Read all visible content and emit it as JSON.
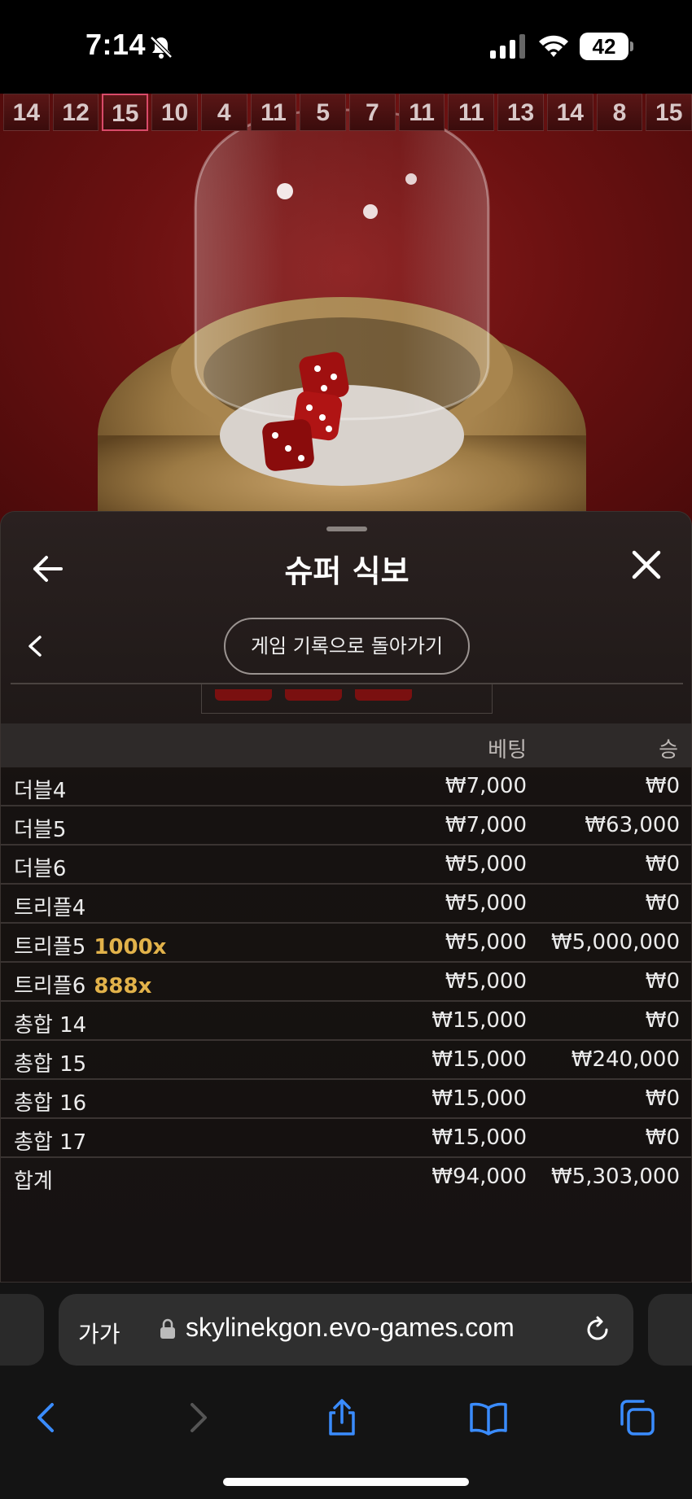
{
  "status_bar": {
    "time": "7:14",
    "battery": "42"
  },
  "game": {
    "history": [
      "14",
      "12",
      "15",
      "10",
      "4",
      "11",
      "5",
      "7",
      "11",
      "11",
      "13",
      "14",
      "8",
      "15"
    ],
    "highlight_index": 2
  },
  "panel": {
    "title": "슈퍼 식보",
    "back_to_history": "게임 기록으로 돌아가기",
    "columns": {
      "bet": "베팅",
      "win": "승"
    },
    "rows": [
      {
        "label": "더블4",
        "multiplier": "",
        "bet": "₩7,000",
        "win": "₩0"
      },
      {
        "label": "더블5",
        "multiplier": "",
        "bet": "₩7,000",
        "win": "₩63,000"
      },
      {
        "label": "더블6",
        "multiplier": "",
        "bet": "₩5,000",
        "win": "₩0"
      },
      {
        "label": "트리플4",
        "multiplier": "",
        "bet": "₩5,000",
        "win": "₩0"
      },
      {
        "label": "트리플5",
        "multiplier": "1000x",
        "bet": "₩5,000",
        "win": "₩5,000,000"
      },
      {
        "label": "트리플6",
        "multiplier": "888x",
        "bet": "₩5,000",
        "win": "₩0"
      },
      {
        "label": "총합 14",
        "multiplier": "",
        "bet": "₩15,000",
        "win": "₩0"
      },
      {
        "label": "총합 15",
        "multiplier": "",
        "bet": "₩15,000",
        "win": "₩240,000"
      },
      {
        "label": "총합 16",
        "multiplier": "",
        "bet": "₩15,000",
        "win": "₩0"
      },
      {
        "label": "총합 17",
        "multiplier": "",
        "bet": "₩15,000",
        "win": "₩0"
      }
    ],
    "total": {
      "label": "합계",
      "bet": "₩94,000",
      "win": "₩5,303,000"
    }
  },
  "browser": {
    "aa": "가가",
    "url": "skylinekgon.evo-games.com"
  },
  "colors": {
    "accent_blue": "#3a8cff",
    "multiplier_gold": "#e2b24a"
  }
}
